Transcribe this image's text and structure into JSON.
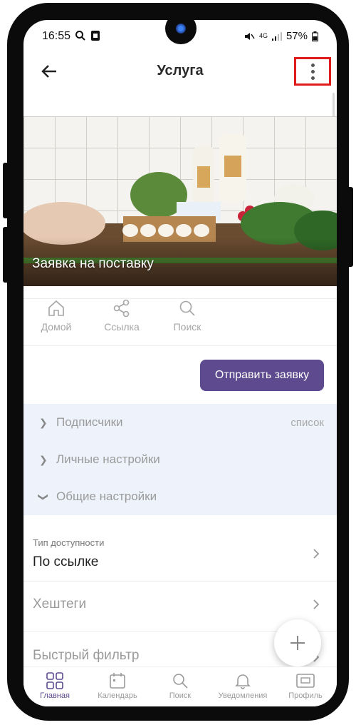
{
  "status_bar": {
    "time": "16:55",
    "network": "4G",
    "battery": "57%"
  },
  "app_bar": {
    "title": "Услуга"
  },
  "hero": {
    "caption": "Заявка на поставку"
  },
  "quick_actions": [
    {
      "label": "Домой",
      "icon": "home-icon"
    },
    {
      "label": "Ссылка",
      "icon": "share-icon"
    },
    {
      "label": "Поиск",
      "icon": "search-icon"
    }
  ],
  "send_request": {
    "label": "Отправить заявку",
    "color": "#5d4a8f"
  },
  "accordion": {
    "items": [
      {
        "label": "Подписчики",
        "value": "список",
        "expanded": false
      },
      {
        "label": "Личные настройки",
        "value": "",
        "expanded": false
      },
      {
        "label": "Общие настройки",
        "value": "",
        "expanded": true
      }
    ]
  },
  "settings": {
    "access_type_label": "Тип доступности",
    "access_type_value": "По ссылке",
    "hashtags_label": "Хештеги",
    "quick_filter_label": "Быстрый фильтр"
  },
  "bottom_nav": [
    {
      "label": "Главная",
      "icon": "grid-icon",
      "active": true
    },
    {
      "label": "Календарь",
      "icon": "calendar-icon",
      "active": false
    },
    {
      "label": "Поиск",
      "icon": "search-icon",
      "active": false
    },
    {
      "label": "Уведомления",
      "icon": "bell-icon",
      "active": false
    },
    {
      "label": "Профиль",
      "icon": "profile-card-icon",
      "active": false
    }
  ],
  "colors": {
    "accent": "#5d4a8f",
    "highlight_frame": "#e01b1b",
    "accordion_bg": "#eef3fb"
  }
}
